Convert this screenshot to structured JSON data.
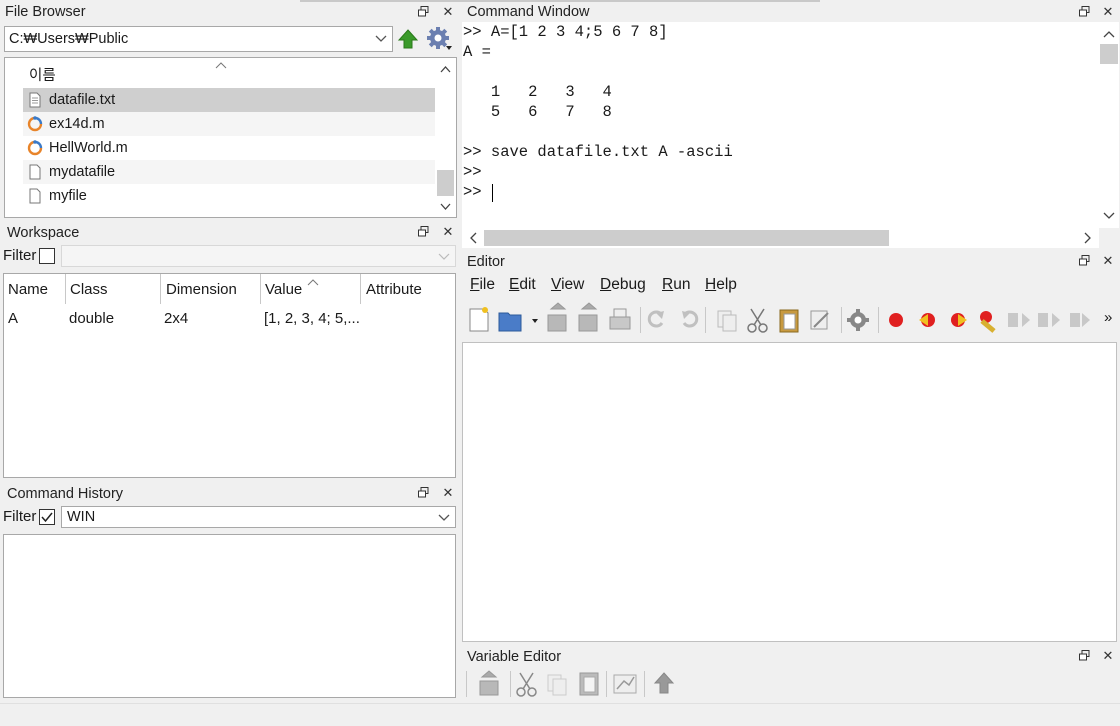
{
  "file_browser": {
    "title": "File Browser",
    "path": "C:₩Users₩Public",
    "column_header": "이름",
    "files": [
      {
        "name": "datafile.txt",
        "icon": "text-file-icon",
        "selected": true
      },
      {
        "name": "ex14d.m",
        "icon": "octave-script-icon",
        "selected": false
      },
      {
        "name": "HellWorld.m",
        "icon": "octave-script-icon",
        "selected": false
      },
      {
        "name": "mydatafile",
        "icon": "blank-file-icon",
        "selected": false
      },
      {
        "name": "myfile",
        "icon": "blank-file-icon",
        "selected": false
      }
    ]
  },
  "workspace": {
    "title": "Workspace",
    "filter_label": "Filter",
    "filter_checked": false,
    "columns": [
      "Name",
      "Class",
      "Dimension",
      "Value",
      "Attribute"
    ],
    "rows": [
      {
        "name": "A",
        "class": "double",
        "dimension": "2x4",
        "value": "[1, 2, 3, 4; 5,...",
        "attribute": ""
      }
    ]
  },
  "command_history": {
    "title": "Command History",
    "filter_label": "Filter",
    "filter_checked": true,
    "filter_value": "WIN"
  },
  "command_window": {
    "title": "Command Window",
    "lines": [
      ">> A=[1 2 3 4;5 6 7 8]",
      "A =",
      "",
      "   1   2   3   4",
      "   5   6   7   8",
      "",
      ">> save datafile.txt A -ascii",
      ">>",
      ">> "
    ]
  },
  "editor": {
    "title": "Editor",
    "menu": [
      {
        "label": "File",
        "u": "F",
        "rest": "ile"
      },
      {
        "label": "Edit",
        "u": "E",
        "rest": "dit"
      },
      {
        "label": "View",
        "u": "V",
        "rest": "iew"
      },
      {
        "label": "Debug",
        "u": "D",
        "rest": "ebug"
      },
      {
        "label": "Run",
        "u": "R",
        "rest": "un"
      },
      {
        "label": "Help",
        "u": "H",
        "rest": "elp"
      }
    ],
    "overflow": "»"
  },
  "variable_editor": {
    "title": "Variable Editor"
  },
  "icons": {
    "float": "undock-icon",
    "close": "close-icon"
  },
  "colors": {
    "selection": "#cfcfcf",
    "breakpoint_red": "#e02020",
    "up_arrow_green": "#3a9a2a"
  }
}
